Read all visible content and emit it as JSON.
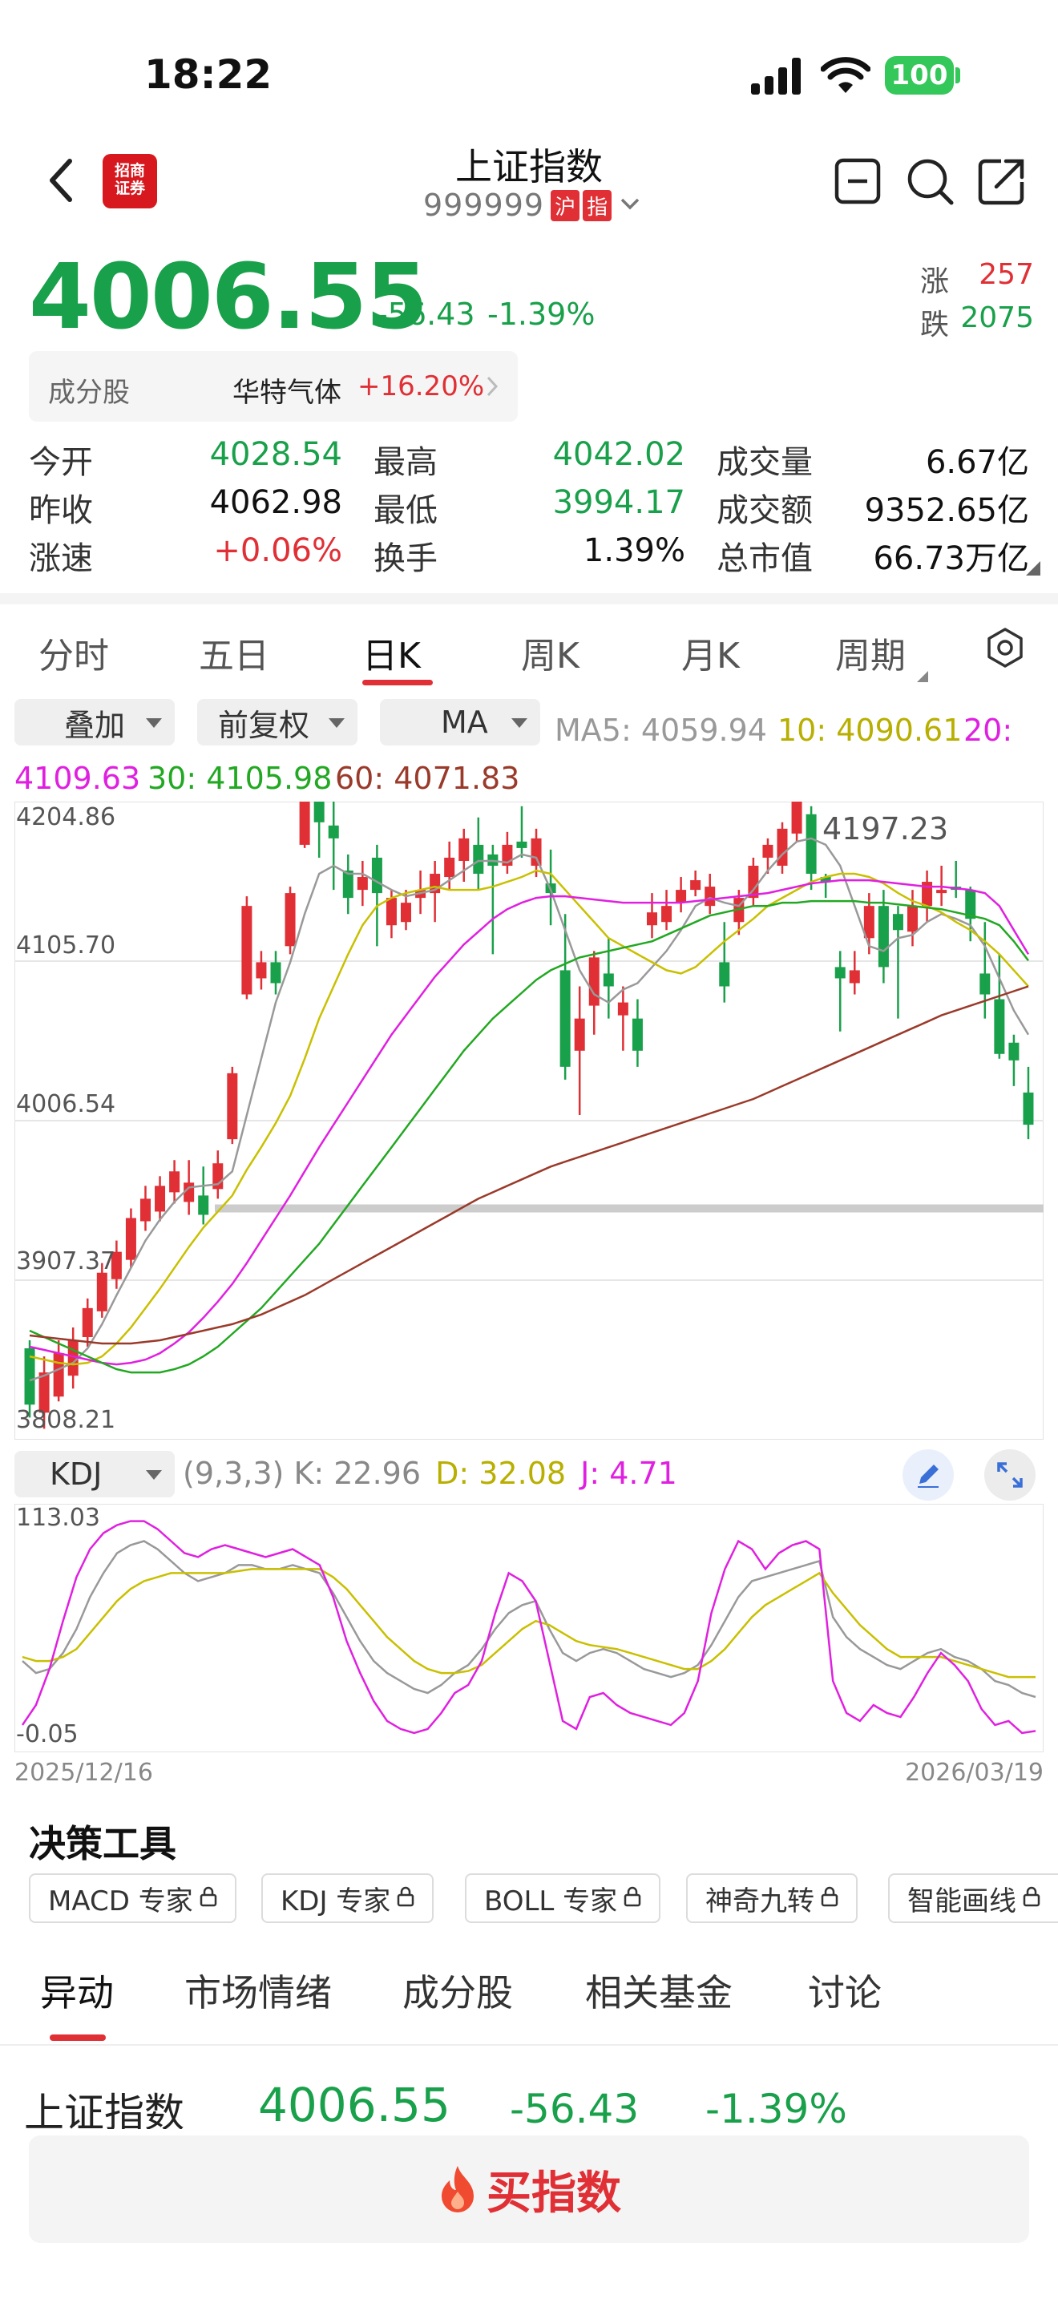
{
  "status_bar": {
    "time": "18:22",
    "battery": "100"
  },
  "header": {
    "title": "上证指数",
    "code": "999999",
    "badge_market": "沪",
    "badge_type": "指",
    "logo_text": "招商\n证券"
  },
  "quote": {
    "price": "4006.55",
    "change": "-56.43",
    "change_pct": "-1.39%",
    "up_label": "涨",
    "up_count": "257",
    "down_label": "跌",
    "down_count": "2075"
  },
  "constituent": {
    "label": "成分股",
    "name": "华特气体",
    "pct": "+16.20%"
  },
  "stats": [
    {
      "label": "今开",
      "value": "4028.54",
      "color": "green"
    },
    {
      "label": "最高",
      "value": "4042.02",
      "color": "green"
    },
    {
      "label": "成交量",
      "value": "6.67亿",
      "color": "black"
    },
    {
      "label": "昨收",
      "value": "4062.98",
      "color": "black"
    },
    {
      "label": "最低",
      "value": "3994.17",
      "color": "green"
    },
    {
      "label": "成交额",
      "value": "9352.65亿",
      "color": "black"
    },
    {
      "label": "涨速",
      "value": "+0.06%",
      "color": "red"
    },
    {
      "label": "换手",
      "value": "1.39%",
      "color": "black"
    },
    {
      "label": "总市值",
      "value": "66.73万亿",
      "color": "black"
    }
  ],
  "chart_tabs": [
    "分时",
    "五日",
    "日K",
    "周K",
    "月K",
    "周期"
  ],
  "active_tab": "日K",
  "controls": {
    "overlay": "叠加",
    "adjust": "前复权",
    "indicator": "MA"
  },
  "ma_legend": {
    "ma5": "MA5: 4059.94",
    "ma10": "10: 4090.61",
    "ma20_label": "20:",
    "ma20_value": "4109.63",
    "ma30": "30: 4105.98",
    "ma60": "60: 4071.83"
  },
  "colors": {
    "up": "#e02f35",
    "down": "#19a04a",
    "ma5": "#999999",
    "ma10": "#c9c000",
    "ma20": "#e020e0",
    "ma30": "#22a822",
    "ma60": "#9a3a2a"
  },
  "chart_data": [
    {
      "type": "candlestick",
      "title": "",
      "y_ticks": [
        "4204.86",
        "4105.70",
        "4006.54",
        "3907.37",
        "3808.21"
      ],
      "ylim": [
        3808.21,
        4204.86
      ],
      "max_annotation": "4197.23",
      "x_start": "2025/12/16",
      "x_end": "2026/03/19",
      "candles": [
        [
          3865,
          3830,
          3870,
          3822
        ],
        [
          3825,
          3850,
          3860,
          3815
        ],
        [
          3835,
          3862,
          3870,
          3832
        ],
        [
          3848,
          3870,
          3878,
          3840
        ],
        [
          3872,
          3890,
          3896,
          3866
        ],
        [
          3888,
          3912,
          3918,
          3884
        ],
        [
          3908,
          3925,
          3932,
          3902
        ],
        [
          3920,
          3946,
          3952,
          3915
        ],
        [
          3944,
          3958,
          3966,
          3938
        ],
        [
          3950,
          3966,
          3972,
          3944
        ],
        [
          3962,
          3975,
          3982,
          3955
        ],
        [
          3956,
          3968,
          3982,
          3948
        ],
        [
          3960,
          3948,
          3978,
          3942
        ],
        [
          3964,
          3980,
          3988,
          3958
        ],
        [
          3995,
          4036,
          4040,
          3992
        ],
        [
          4085,
          4140,
          4146,
          4082
        ],
        [
          4095,
          4105,
          4112,
          4088
        ],
        [
          4105,
          4092,
          4112,
          4085
        ],
        [
          4115,
          4148,
          4152,
          4110
        ],
        [
          4178,
          4215,
          4218,
          4176
        ],
        [
          4218,
          4192,
          4228,
          4170
        ],
        [
          4190,
          4182,
          4235,
          4150
        ],
        [
          4162,
          4145,
          4172,
          4135
        ],
        [
          4150,
          4158,
          4168,
          4140
        ],
        [
          4170,
          4148,
          4178,
          4115
        ],
        [
          4128,
          4145,
          4150,
          4120
        ],
        [
          4130,
          4142,
          4150,
          4125
        ],
        [
          4145,
          4150,
          4162,
          4135
        ],
        [
          4148,
          4160,
          4168,
          4130
        ],
        [
          4158,
          4170,
          4180,
          4150
        ],
        [
          4168,
          4182,
          4188,
          4155
        ],
        [
          4178,
          4160,
          4195,
          4150
        ],
        [
          4172,
          4165,
          4178,
          4110
        ],
        [
          4165,
          4178,
          4186,
          4160
        ],
        [
          4180,
          4176,
          4202,
          4170
        ],
        [
          4165,
          4182,
          4188,
          4158
        ],
        [
          4154,
          4148,
          4175,
          4128
        ],
        [
          4100,
          4040,
          4135,
          4032
        ],
        [
          4050,
          4070,
          4090,
          4010
        ],
        [
          4078,
          4108,
          4112,
          4060
        ],
        [
          4098,
          4090,
          4120,
          4070
        ],
        [
          4072,
          4080,
          4090,
          4050
        ],
        [
          4070,
          4050,
          4082,
          4040
        ],
        [
          4128,
          4136,
          4148,
          4120
        ],
        [
          4130,
          4140,
          4150,
          4125
        ],
        [
          4142,
          4150,
          4158,
          4136
        ],
        [
          4150,
          4156,
          4162,
          4146
        ],
        [
          4140,
          4152,
          4160,
          4135
        ],
        [
          4105,
          4090,
          4130,
          4080
        ],
        [
          4130,
          4145,
          4150,
          4122
        ],
        [
          4145,
          4165,
          4170,
          4140
        ],
        [
          4170,
          4178,
          4182,
          4160
        ],
        [
          4165,
          4188,
          4192,
          4160
        ],
        [
          4185,
          4205,
          4210,
          4180
        ],
        [
          4197,
          4160,
          4202,
          4150
        ],
        [
          4158,
          4155,
          4160,
          4145
        ],
        [
          4102,
          4095,
          4112,
          4062
        ],
        [
          4092,
          4100,
          4112,
          4085
        ],
        [
          4120,
          4140,
          4148,
          4110
        ],
        [
          4140,
          4102,
          4150,
          4092
        ],
        [
          4135,
          4125,
          4140,
          4070
        ],
        [
          4124,
          4140,
          4150,
          4115
        ],
        [
          4140,
          4155,
          4162,
          4130
        ],
        [
          4148,
          4150,
          4165,
          4140
        ],
        [
          4152,
          4150,
          4168,
          4145
        ],
        [
          4150,
          4132,
          4152,
          4118
        ],
        [
          4098,
          4085,
          4130,
          4070
        ],
        [
          4082,
          4048,
          4110,
          4045
        ],
        [
          4055,
          4044,
          4060,
          4028
        ],
        [
          4024,
          4004,
          4040,
          3995
        ]
      ],
      "ma_series": [
        {
          "name": "MA5",
          "values": [
            3845,
            3848,
            3852,
            3856,
            3865,
            3880,
            3898,
            3915,
            3932,
            3945,
            3956,
            3965,
            3966,
            3967,
            3975,
            4010,
            4045,
            4080,
            4105,
            4135,
            4160,
            4165,
            4160,
            4160,
            4155,
            4150,
            4146,
            4148,
            4150,
            4156,
            4162,
            4168,
            4168,
            4167,
            4172,
            4170,
            4150,
            4125,
            4100,
            4085,
            4080,
            4088,
            4092,
            4102,
            4112,
            4125,
            4140,
            4145,
            4142,
            4140,
            4150,
            4162,
            4172,
            4180,
            4182,
            4178,
            4165,
            4140,
            4115,
            4112,
            4120,
            4122,
            4130,
            4135,
            4132,
            4128,
            4115,
            4095,
            4075,
            4060
          ]
        },
        {
          "name": "10",
          "values": [
            3860,
            3858,
            3856,
            3855,
            3856,
            3860,
            3868,
            3878,
            3890,
            3902,
            3915,
            3928,
            3940,
            3950,
            3960,
            3976,
            3990,
            4005,
            4022,
            4045,
            4070,
            4090,
            4110,
            4128,
            4140,
            4145,
            4148,
            4150,
            4152,
            4150,
            4150,
            4150,
            4152,
            4155,
            4158,
            4162,
            4160,
            4150,
            4140,
            4130,
            4120,
            4115,
            4110,
            4105,
            4100,
            4098,
            4102,
            4110,
            4118,
            4125,
            4132,
            4140,
            4145,
            4150,
            4155,
            4158,
            4160,
            4160,
            4158,
            4154,
            4148,
            4143,
            4140,
            4136,
            4130,
            4125,
            4118,
            4110,
            4100,
            4090
          ]
        },
        {
          "name": "20",
          "values": [
            3866,
            3864,
            3862,
            3860,
            3858,
            3856,
            3855,
            3856,
            3858,
            3862,
            3868,
            3875,
            3884,
            3894,
            3905,
            3918,
            3932,
            3946,
            3960,
            3975,
            3990,
            4004,
            4018,
            4032,
            4046,
            4060,
            4072,
            4084,
            4096,
            4106,
            4116,
            4124,
            4132,
            4138,
            4142,
            4145,
            4146,
            4146,
            4145,
            4144,
            4143,
            4142,
            4142,
            4142,
            4142,
            4142,
            4143,
            4144,
            4145,
            4146,
            4147,
            4148,
            4150,
            4152,
            4154,
            4155,
            4156,
            4156,
            4156,
            4155,
            4154,
            4153,
            4152,
            4152,
            4151,
            4150,
            4148,
            4140,
            4125,
            4110
          ]
        },
        {
          "name": "30",
          "values": [
            3876,
            3872,
            3868,
            3864,
            3860,
            3856,
            3852,
            3850,
            3850,
            3850,
            3852,
            3855,
            3860,
            3866,
            3874,
            3882,
            3890,
            3900,
            3910,
            3920,
            3930,
            3942,
            3954,
            3966,
            3978,
            3990,
            4002,
            4014,
            4026,
            4038,
            4050,
            4060,
            4070,
            4078,
            4086,
            4094,
            4100,
            4104,
            4108,
            4110,
            4112,
            4114,
            4116,
            4118,
            4122,
            4126,
            4130,
            4134,
            4136,
            4138,
            4140,
            4140,
            4142,
            4142,
            4143,
            4143,
            4143,
            4143,
            4142,
            4142,
            4141,
            4140,
            4139,
            4138,
            4136,
            4134,
            4132,
            4128,
            4118,
            4106
          ]
        },
        {
          "name": "60",
          "values": [
            3873,
            3872,
            3871,
            3870,
            3869,
            3868,
            3868,
            3868,
            3869,
            3870,
            3872,
            3874,
            3876,
            3878,
            3880,
            3883,
            3886,
            3890,
            3894,
            3898,
            3903,
            3908,
            3913,
            3918,
            3923,
            3928,
            3933,
            3938,
            3943,
            3948,
            3953,
            3958,
            3962,
            3966,
            3970,
            3974,
            3978,
            3981,
            3984,
            3987,
            3990,
            3993,
            3996,
            3999,
            4002,
            4005,
            4008,
            4011,
            4014,
            4017,
            4020,
            4024,
            4028,
            4032,
            4036,
            4040,
            4044,
            4048,
            4052,
            4056,
            4060,
            4064,
            4068,
            4072,
            4075,
            4078,
            4081,
            4084,
            4087,
            4090
          ]
        }
      ]
    },
    {
      "type": "line",
      "title": "",
      "indicator": "KDJ",
      "params": "(9,3,3)",
      "legend": {
        "k": "K: 22.96",
        "d": "D: 32.08",
        "j": "J: 4.71"
      },
      "y_ticks": [
        "113.03",
        "-0.05"
      ],
      "ylim": [
        -0.05,
        113.03
      ],
      "series": [
        {
          "name": "K",
          "values": [
            40,
            34,
            36,
            44,
            56,
            72,
            84,
            94,
            98,
            100,
            96,
            90,
            84,
            80,
            82,
            84,
            88,
            88,
            86,
            86,
            88,
            86,
            84,
            74,
            62,
            50,
            40,
            34,
            30,
            26,
            24,
            28,
            34,
            38,
            46,
            56,
            64,
            68,
            70,
            56,
            44,
            40,
            44,
            46,
            44,
            40,
            36,
            34,
            32,
            34,
            38,
            48,
            60,
            72,
            80,
            82,
            84,
            86,
            88,
            90,
            62,
            52,
            46,
            42,
            38,
            36,
            40,
            44,
            46,
            42,
            40,
            36,
            30,
            28,
            24,
            22
          ]
        },
        {
          "name": "D",
          "values": [
            42,
            40,
            40,
            42,
            46,
            54,
            62,
            70,
            76,
            80,
            82,
            84,
            84,
            84,
            84,
            84,
            85,
            86,
            86,
            86,
            86,
            86,
            86,
            82,
            76,
            68,
            60,
            52,
            46,
            40,
            36,
            34,
            34,
            35,
            38,
            44,
            50,
            56,
            60,
            58,
            54,
            50,
            48,
            47,
            46,
            44,
            42,
            40,
            38,
            36,
            36,
            40,
            46,
            54,
            62,
            68,
            72,
            76,
            80,
            84,
            74,
            66,
            58,
            52,
            46,
            42,
            42,
            42,
            42,
            40,
            38,
            36,
            34,
            32,
            32,
            32
          ]
        },
        {
          "name": "J",
          "values": [
            8,
            18,
            36,
            60,
            82,
            96,
            104,
            108,
            110,
            110,
            106,
            100,
            94,
            92,
            96,
            98,
            96,
            94,
            92,
            94,
            96,
            92,
            88,
            72,
            50,
            34,
            20,
            10,
            6,
            4,
            6,
            14,
            24,
            28,
            40,
            64,
            84,
            80,
            70,
            40,
            10,
            6,
            22,
            24,
            18,
            14,
            12,
            10,
            8,
            14,
            30,
            64,
            86,
            100,
            96,
            86,
            94,
            98,
            100,
            96,
            30,
            14,
            10,
            18,
            14,
            12,
            22,
            34,
            44,
            38,
            30,
            16,
            8,
            10,
            4,
            5
          ]
        }
      ]
    }
  ],
  "kdj_controls": {
    "indicator": "KDJ",
    "params": "(9,3,3)",
    "k": "K: 22.96",
    "d": "D: 32.08",
    "j": "J: 4.71"
  },
  "x_axis": {
    "start": "2025/12/16",
    "end": "2026/03/19"
  },
  "tools": {
    "title": "决策工具",
    "chips": [
      "MACD 专家",
      "KDJ 专家",
      "BOLL 专家",
      "神奇九转",
      "智能画线"
    ]
  },
  "bottom_tabs": [
    "异动",
    "市场情绪",
    "成分股",
    "相关基金",
    "讨论"
  ],
  "footer_quote": {
    "name": "上证指数",
    "price": "4006.55",
    "change": "-56.43",
    "pct": "-1.39%"
  },
  "buy_button": {
    "label": "买指数"
  }
}
